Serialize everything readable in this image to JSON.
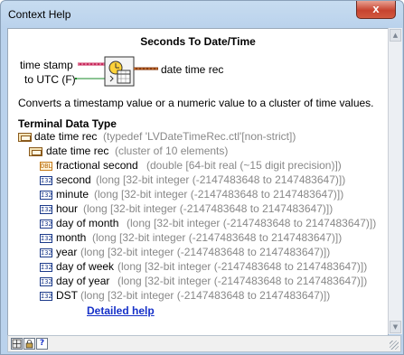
{
  "window": {
    "title": "Context Help",
    "close_glyph": "x"
  },
  "function": {
    "name": "Seconds To Date/Time",
    "input1": "time stamp",
    "input2": "to UTC (F)",
    "output": "date time rec",
    "description": "Converts a timestamp value or a numeric value to a cluster of time values."
  },
  "terminal": {
    "heading": "Terminal Data Type",
    "root": {
      "name": "date time rec",
      "type": "(typedef 'LVDateTimeRec.ctl'[non-strict])"
    },
    "cluster": {
      "name": "date time rec",
      "type": "(cluster of 10 elements)"
    },
    "elements": [
      {
        "name": "fractional second",
        "type": "(double [64-bit real (~15 digit precision)])"
      },
      {
        "name": "second",
        "type": "(long [32-bit integer (-2147483648 to 2147483647)])"
      },
      {
        "name": "minute",
        "type": "(long [32-bit integer (-2147483648 to 2147483647)])"
      },
      {
        "name": "hour",
        "type": "(long [32-bit integer (-2147483648 to 2147483647)])"
      },
      {
        "name": "day of month",
        "type": "(long [32-bit integer (-2147483648 to 2147483647)])"
      },
      {
        "name": "month",
        "type": "(long [32-bit integer (-2147483648 to 2147483647)])"
      },
      {
        "name": "year",
        "type": "(long [32-bit integer (-2147483648 to 2147483647)])"
      },
      {
        "name": "day of week",
        "type": "(long [32-bit integer (-2147483648 to 2147483647)])"
      },
      {
        "name": "day of year",
        "type": "(long [32-bit integer (-2147483648 to 2147483647)])"
      },
      {
        "name": "DST",
        "type": "(long [32-bit integer (-2147483648 to 2147483647)])"
      }
    ]
  },
  "links": {
    "detailed_help": "Detailed help"
  },
  "icons": {
    "double_icon": "DBL",
    "long_icon": "I32",
    "help_icon": "?"
  },
  "colors": {
    "accent_link": "#1530c8",
    "wire_pink": "#c8285a",
    "wire_orange": "#c47a1a",
    "close_red": "#c7432f"
  }
}
